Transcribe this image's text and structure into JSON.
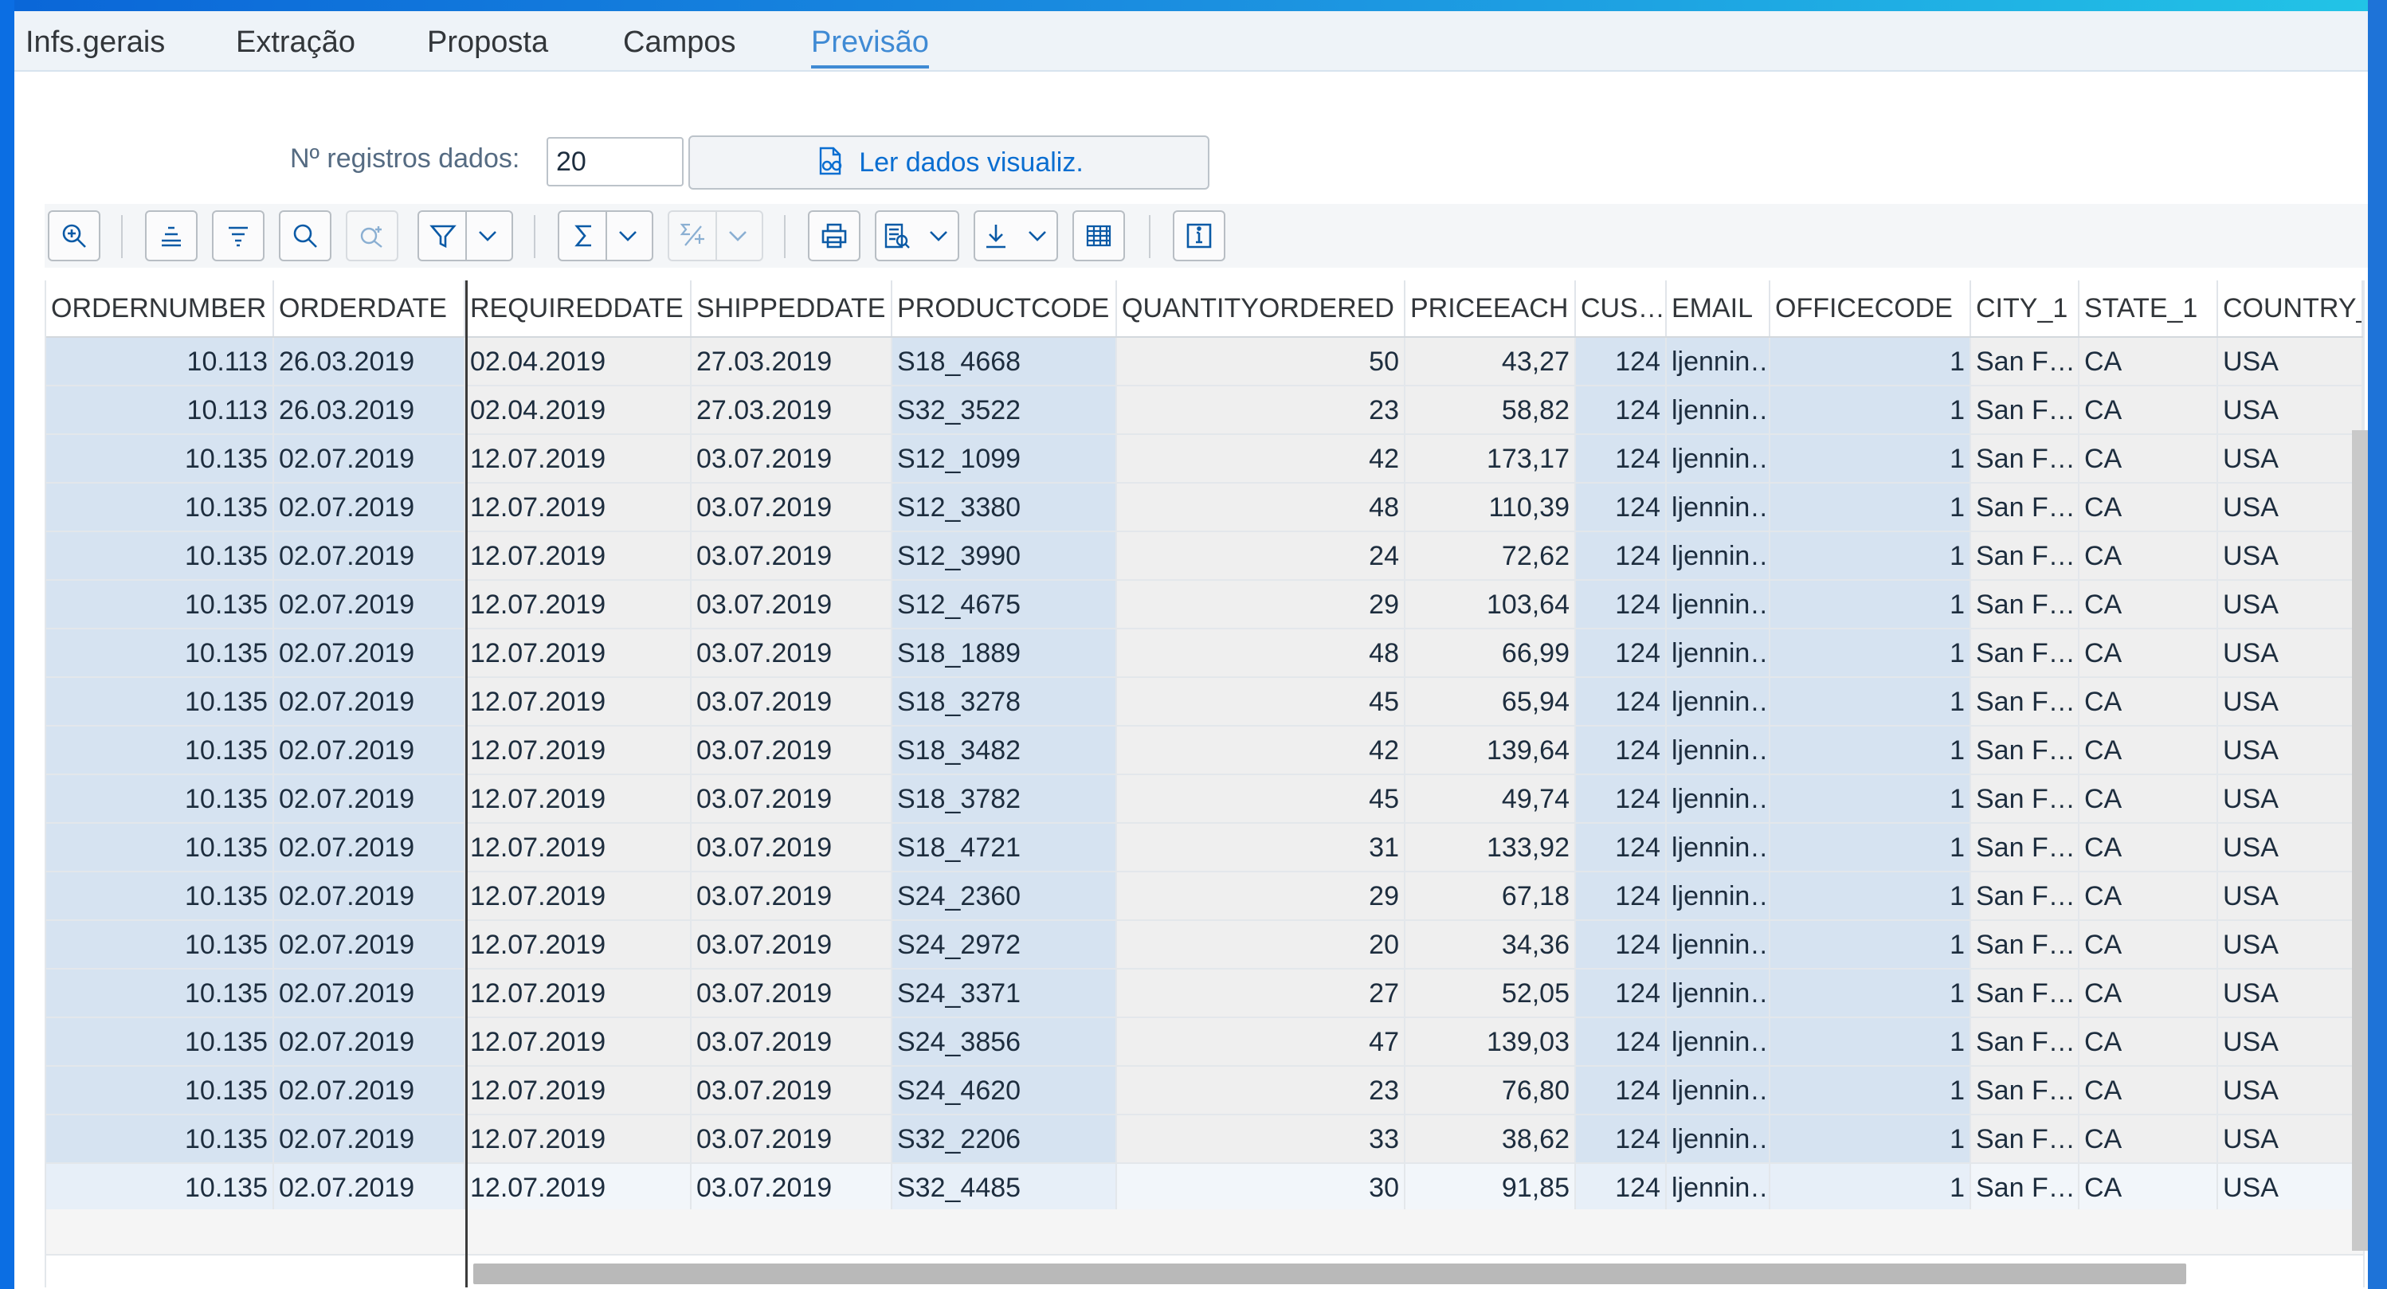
{
  "tabs": [
    {
      "label": "Infs.gerais",
      "active": false
    },
    {
      "label": "Extração",
      "active": false
    },
    {
      "label": "Proposta",
      "active": false
    },
    {
      "label": "Campos",
      "active": false
    },
    {
      "label": "Previsão",
      "active": true
    }
  ],
  "records": {
    "label": "Nº registros dados:",
    "value": "20",
    "button_label": "Ler dados visualiz."
  },
  "toolbar": {
    "icons": [
      "zoom-icon",
      "sort-ascending-icon",
      "sort-descending-icon",
      "search-icon",
      "search-next-icon",
      "filter-icon",
      "sum-icon",
      "subtotal-icon",
      "print-icon",
      "views-icon",
      "export-icon",
      "spreadsheet-icon",
      "info-icon"
    ]
  },
  "colors": {
    "accent": "#3f8ad4",
    "key_column_bg": "#d6e3f1",
    "plain_column_bg": "#efefef"
  },
  "table": {
    "columns": [
      "ORDERNUMBER",
      "ORDERDATE",
      "REQUIREDDATE",
      "SHIPPEDDATE",
      "PRODUCTCODE",
      "QUANTITYORDERED",
      "PRICEEACH",
      "CUS…",
      "EMAIL",
      "OFFICECODE",
      "CITY_1",
      "STATE_1",
      "COUNTRY_"
    ],
    "rows": [
      [
        "10.113",
        "26.03.2019",
        "02.04.2019",
        "27.03.2019",
        "S18_4668",
        "50",
        "43,27",
        "124",
        "ljennin…",
        "1",
        "San F…",
        "CA",
        "USA"
      ],
      [
        "10.113",
        "26.03.2019",
        "02.04.2019",
        "27.03.2019",
        "S32_3522",
        "23",
        "58,82",
        "124",
        "ljennin…",
        "1",
        "San F…",
        "CA",
        "USA"
      ],
      [
        "10.135",
        "02.07.2019",
        "12.07.2019",
        "03.07.2019",
        "S12_1099",
        "42",
        "173,17",
        "124",
        "ljennin…",
        "1",
        "San F…",
        "CA",
        "USA"
      ],
      [
        "10.135",
        "02.07.2019",
        "12.07.2019",
        "03.07.2019",
        "S12_3380",
        "48",
        "110,39",
        "124",
        "ljennin…",
        "1",
        "San F…",
        "CA",
        "USA"
      ],
      [
        "10.135",
        "02.07.2019",
        "12.07.2019",
        "03.07.2019",
        "S12_3990",
        "24",
        "72,62",
        "124",
        "ljennin…",
        "1",
        "San F…",
        "CA",
        "USA"
      ],
      [
        "10.135",
        "02.07.2019",
        "12.07.2019",
        "03.07.2019",
        "S12_4675",
        "29",
        "103,64",
        "124",
        "ljennin…",
        "1",
        "San F…",
        "CA",
        "USA"
      ],
      [
        "10.135",
        "02.07.2019",
        "12.07.2019",
        "03.07.2019",
        "S18_1889",
        "48",
        "66,99",
        "124",
        "ljennin…",
        "1",
        "San F…",
        "CA",
        "USA"
      ],
      [
        "10.135",
        "02.07.2019",
        "12.07.2019",
        "03.07.2019",
        "S18_3278",
        "45",
        "65,94",
        "124",
        "ljennin…",
        "1",
        "San F…",
        "CA",
        "USA"
      ],
      [
        "10.135",
        "02.07.2019",
        "12.07.2019",
        "03.07.2019",
        "S18_3482",
        "42",
        "139,64",
        "124",
        "ljennin…",
        "1",
        "San F…",
        "CA",
        "USA"
      ],
      [
        "10.135",
        "02.07.2019",
        "12.07.2019",
        "03.07.2019",
        "S18_3782",
        "45",
        "49,74",
        "124",
        "ljennin…",
        "1",
        "San F…",
        "CA",
        "USA"
      ],
      [
        "10.135",
        "02.07.2019",
        "12.07.2019",
        "03.07.2019",
        "S18_4721",
        "31",
        "133,92",
        "124",
        "ljennin…",
        "1",
        "San F…",
        "CA",
        "USA"
      ],
      [
        "10.135",
        "02.07.2019",
        "12.07.2019",
        "03.07.2019",
        "S24_2360",
        "29",
        "67,18",
        "124",
        "ljennin…",
        "1",
        "San F…",
        "CA",
        "USA"
      ],
      [
        "10.135",
        "02.07.2019",
        "12.07.2019",
        "03.07.2019",
        "S24_2972",
        "20",
        "34,36",
        "124",
        "ljennin…",
        "1",
        "San F…",
        "CA",
        "USA"
      ],
      [
        "10.135",
        "02.07.2019",
        "12.07.2019",
        "03.07.2019",
        "S24_3371",
        "27",
        "52,05",
        "124",
        "ljennin…",
        "1",
        "San F…",
        "CA",
        "USA"
      ],
      [
        "10.135",
        "02.07.2019",
        "12.07.2019",
        "03.07.2019",
        "S24_3856",
        "47",
        "139,03",
        "124",
        "ljennin…",
        "1",
        "San F…",
        "CA",
        "USA"
      ],
      [
        "10.135",
        "02.07.2019",
        "12.07.2019",
        "03.07.2019",
        "S24_4620",
        "23",
        "76,80",
        "124",
        "ljennin…",
        "1",
        "San F…",
        "CA",
        "USA"
      ],
      [
        "10.135",
        "02.07.2019",
        "12.07.2019",
        "03.07.2019",
        "S32_2206",
        "33",
        "38,62",
        "124",
        "ljennin…",
        "1",
        "San F…",
        "CA",
        "USA"
      ],
      [
        "10.135",
        "02.07.2019",
        "12.07.2019",
        "03.07.2019",
        "S32_4485",
        "30",
        "91,85",
        "124",
        "ljennin…",
        "1",
        "San F…",
        "CA",
        "USA"
      ]
    ]
  }
}
